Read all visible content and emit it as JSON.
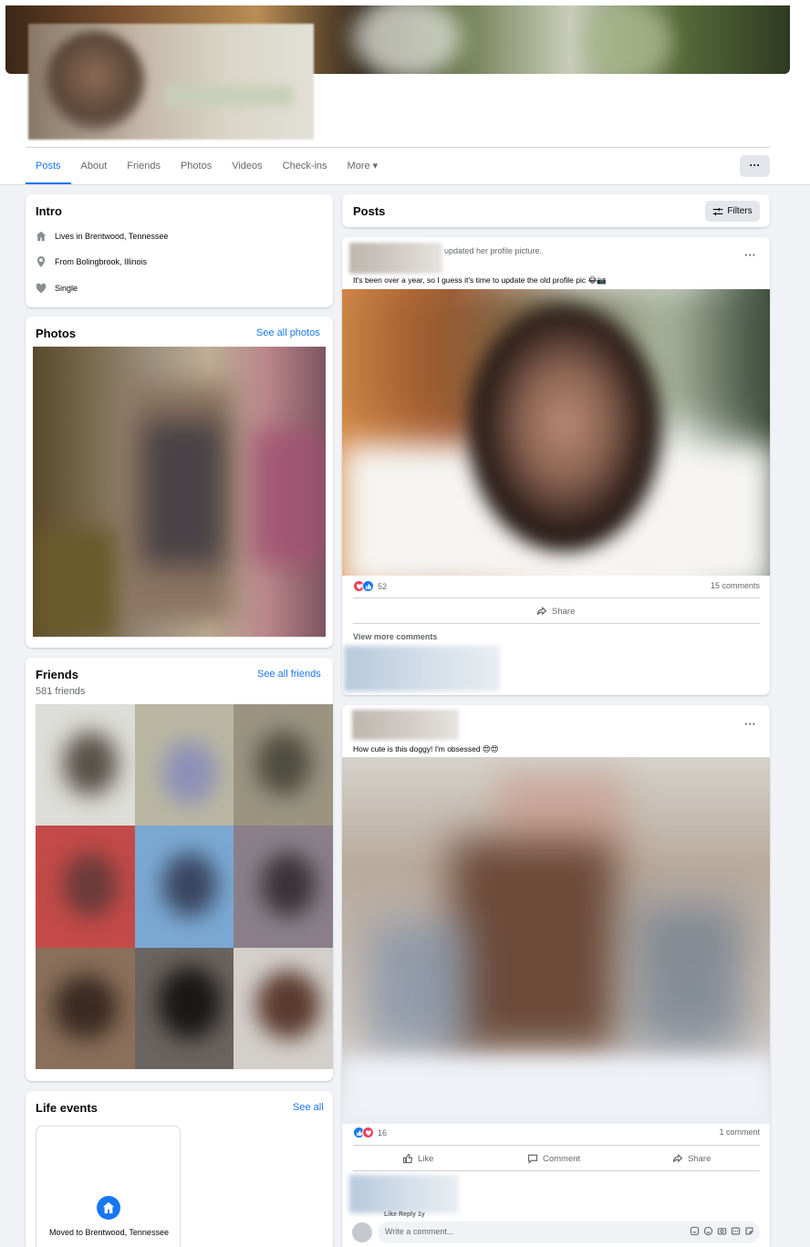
{
  "tabs": [
    "Posts",
    "About",
    "Friends",
    "Photos",
    "Videos",
    "Check-ins",
    "More ▾"
  ],
  "more_menu": "···",
  "intro": {
    "title": "Intro",
    "lives_in_prefix": "Lives in ",
    "lives_in": "Brentwood, Tennessee",
    "from_prefix": "From ",
    "from": "Bolingbrook, Illinois",
    "relationship": "Single"
  },
  "photos": {
    "title": "Photos",
    "see_all": "See all photos"
  },
  "friends": {
    "title": "Friends",
    "see_all": "See all friends",
    "count": "581 friends"
  },
  "life_events": {
    "title": "Life events",
    "see_all": "See all",
    "event": "Moved to Brentwood, Tennessee"
  },
  "posts": {
    "title": "Posts",
    "filters": "Filters",
    "post1": {
      "action": "updated her profile picture.",
      "text": "It's been over a year, so I guess it's time to update the old profile pic 😂📷",
      "reaction_count": "52",
      "comments": "15 comments",
      "share": "Share",
      "view_more": "View more comments"
    },
    "post2": {
      "text": "How cute is this doggy! I'm obsessed 😍😍",
      "reaction_count": "16",
      "comments": "1 comment",
      "like": "Like",
      "comment": "Comment",
      "share": "Share",
      "comment_actions": "Like  Reply  1y",
      "write_placeholder": "Write a comment..."
    }
  },
  "colors": {
    "accent": "#1877f2",
    "background": "#f0f2f5",
    "love": "#f33e58"
  }
}
